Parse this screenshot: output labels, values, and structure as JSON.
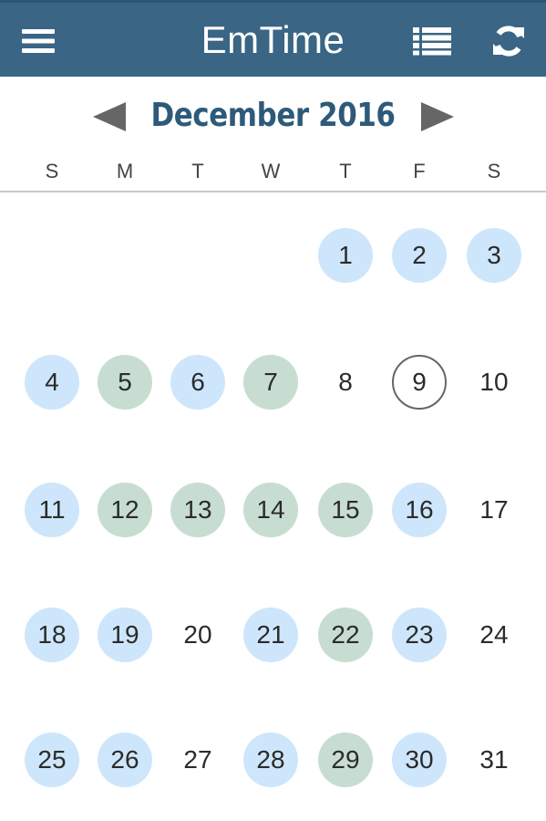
{
  "app": {
    "title": "EmTime"
  },
  "header": {
    "menu_icon": "hamburger-menu-icon",
    "list_icon": "list-view-icon",
    "refresh_icon": "refresh-icon"
  },
  "calendar": {
    "month_label": "December 2016",
    "prev_icon": "prev-month-arrow-icon",
    "next_icon": "next-month-arrow-icon",
    "weekdays": [
      "S",
      "M",
      "T",
      "W",
      "T",
      "F",
      "S"
    ],
    "status_colors": {
      "blue": "#cde6fb",
      "green": "#c7ddd1",
      "today_ring": "#666666"
    },
    "days": [
      {
        "day": "1",
        "status": "blue"
      },
      {
        "day": "2",
        "status": "blue"
      },
      {
        "day": "3",
        "status": "blue"
      },
      {
        "day": "4",
        "status": "blue"
      },
      {
        "day": "5",
        "status": "green"
      },
      {
        "day": "6",
        "status": "blue"
      },
      {
        "day": "7",
        "status": "green"
      },
      {
        "day": "8",
        "status": "none"
      },
      {
        "day": "9",
        "status": "today"
      },
      {
        "day": "10",
        "status": "none"
      },
      {
        "day": "11",
        "status": "blue"
      },
      {
        "day": "12",
        "status": "green"
      },
      {
        "day": "13",
        "status": "green"
      },
      {
        "day": "14",
        "status": "green"
      },
      {
        "day": "15",
        "status": "green"
      },
      {
        "day": "16",
        "status": "blue"
      },
      {
        "day": "17",
        "status": "none"
      },
      {
        "day": "18",
        "status": "blue"
      },
      {
        "day": "19",
        "status": "blue"
      },
      {
        "day": "20",
        "status": "none"
      },
      {
        "day": "21",
        "status": "blue"
      },
      {
        "day": "22",
        "status": "green"
      },
      {
        "day": "23",
        "status": "blue"
      },
      {
        "day": "24",
        "status": "none"
      },
      {
        "day": "25",
        "status": "blue"
      },
      {
        "day": "26",
        "status": "blue"
      },
      {
        "day": "27",
        "status": "none"
      },
      {
        "day": "28",
        "status": "blue"
      },
      {
        "day": "29",
        "status": "green"
      },
      {
        "day": "30",
        "status": "blue"
      },
      {
        "day": "31",
        "status": "none"
      }
    ]
  }
}
